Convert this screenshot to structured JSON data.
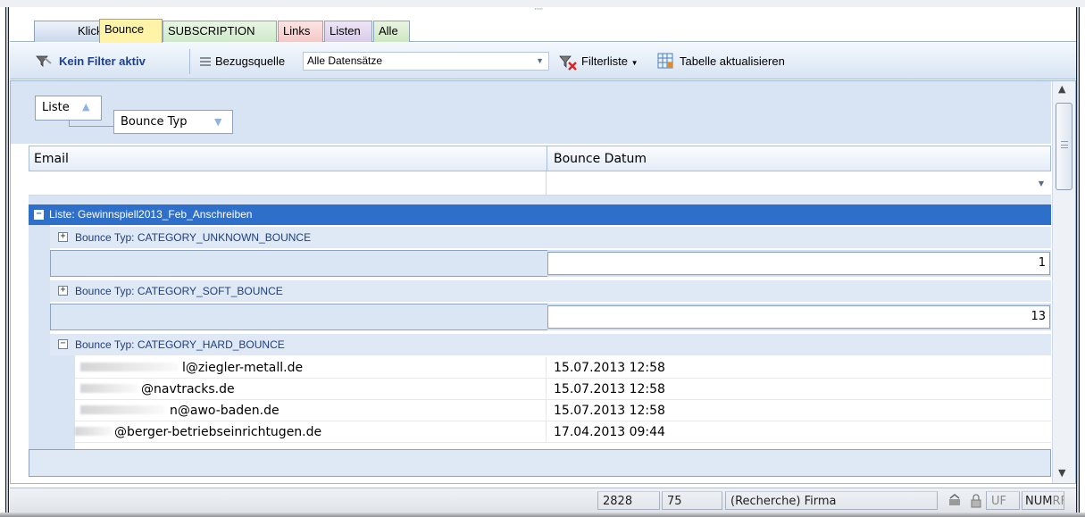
{
  "tabs": [
    {
      "label": "Klicks"
    },
    {
      "label": "Bounce"
    },
    {
      "label": "SUBSCRIPTION"
    },
    {
      "label": "Links"
    },
    {
      "label": "Listen"
    },
    {
      "label": "Alle"
    }
  ],
  "toolbar": {
    "filter_label": "Kein Filter aktiv",
    "source_label": "Bezugsquelle",
    "source_value": "Alle Datensätze",
    "filterlist_label": "Filterliste",
    "refresh_label": "Tabelle aktualisieren"
  },
  "group_panel": {
    "group1": "Liste",
    "group2": "Bounce Typ"
  },
  "columns": {
    "email": "Email",
    "date": "Bounce Datum"
  },
  "group_list": "Liste: Gewinnspiell2013_Feb_Anschreiben",
  "groups": [
    {
      "label": "Bounce Typ: CATEGORY_UNKNOWN_BOUNCE",
      "count": "1"
    },
    {
      "label": "Bounce Typ: CATEGORY_SOFT_BOUNCE",
      "count": "13"
    },
    {
      "label": "Bounce Typ: CATEGORY_HARD_BOUNCE"
    }
  ],
  "rows": [
    {
      "email": "l@ziegler-metall.de",
      "date": "15.07.2013 12:58"
    },
    {
      "email": "@navtracks.de",
      "date": "15.07.2013 12:58"
    },
    {
      "email": "n@awo-baden.de",
      "date": "15.07.2013 12:58"
    },
    {
      "email": "@berger-betriebseinrichtugen.de",
      "date": "17.04.2013 09:44"
    }
  ],
  "status": {
    "count1": "2828",
    "count2": "75",
    "mode": "(Recherche)",
    "context": "Firma",
    "uf": "UF",
    "num": "NUM",
    "rf": "RF"
  }
}
